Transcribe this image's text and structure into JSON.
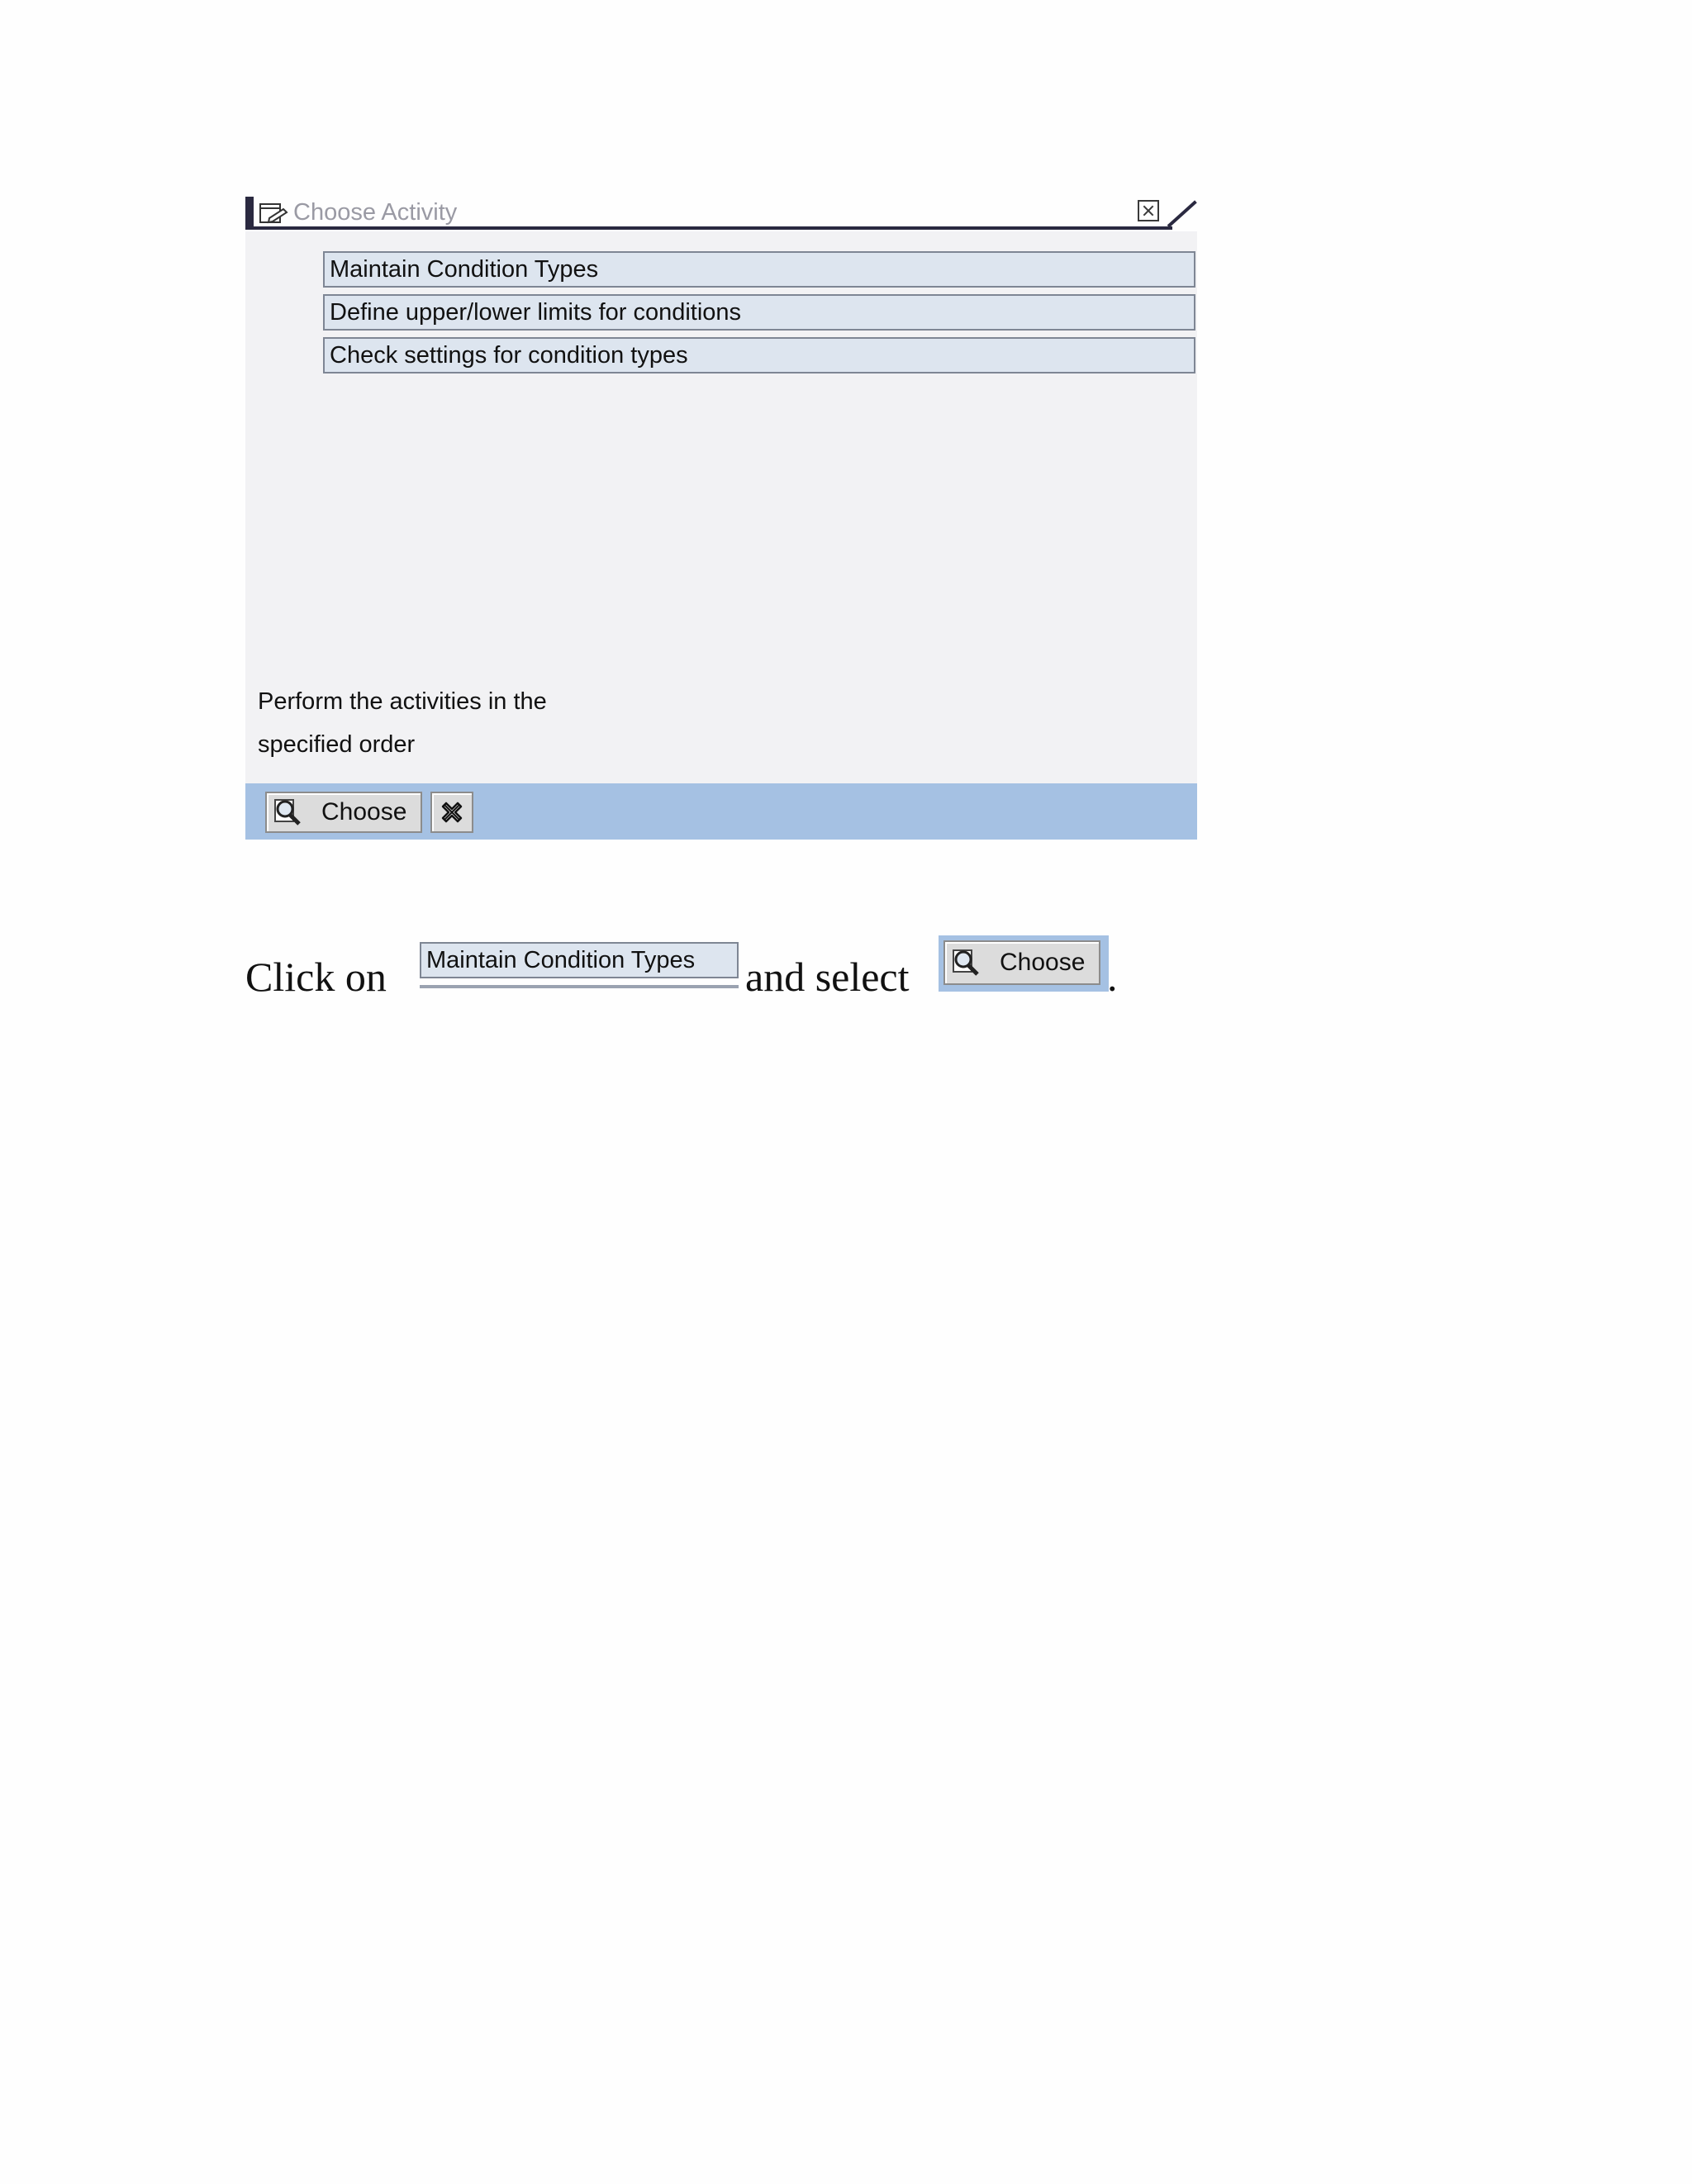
{
  "dialog": {
    "title": "Choose Activity",
    "activities": [
      "Maintain Condition Types",
      "Define upper/lower limits for conditions",
      "Check settings for condition types"
    ],
    "hint_line1": "Perform the activities in the",
    "hint_line2": "specified order",
    "choose_label": "Choose"
  },
  "instruction": {
    "prefix": "Click on",
    "inline_activity": "Maintain Condition Types",
    "middle": "and select",
    "inline_choose": "Choose",
    "suffix": "."
  },
  "colors": {
    "title_rule": "#2a2940",
    "dialog_bg": "#f2f2f4",
    "row_bg": "#dde5ef",
    "footer_bg": "#a5c1e3"
  }
}
